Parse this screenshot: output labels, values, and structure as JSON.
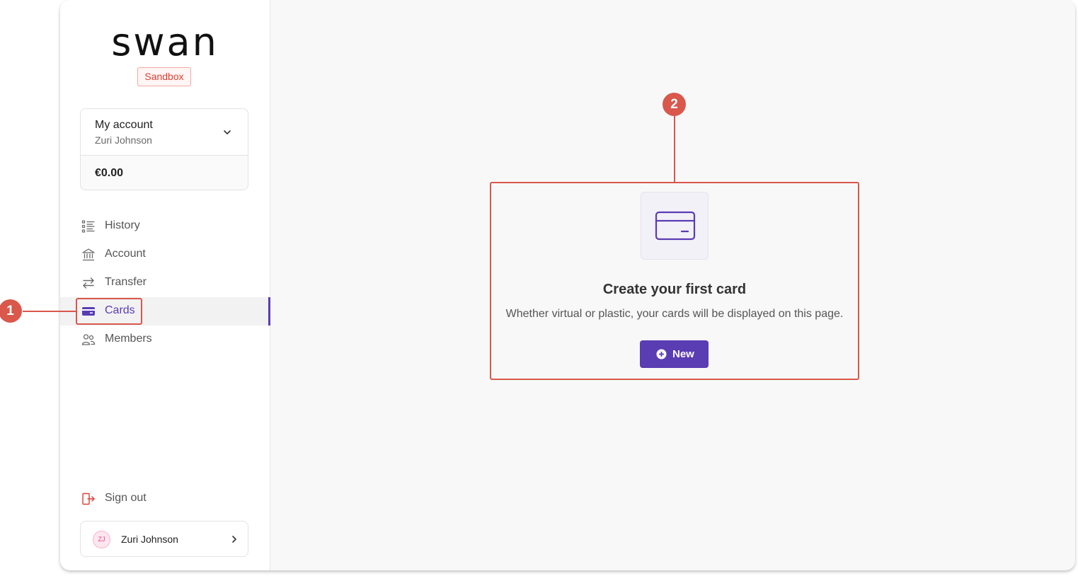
{
  "sidebar": {
    "logo_text": "swan",
    "environment_badge": "Sandbox",
    "account": {
      "title": "My account",
      "holder": "Zuri Johnson",
      "balance": "€0.00"
    },
    "nav": [
      {
        "label": "History",
        "icon": "list-icon"
      },
      {
        "label": "Account",
        "icon": "bank-icon"
      },
      {
        "label": "Transfer",
        "icon": "transfer-icon"
      },
      {
        "label": "Cards",
        "icon": "card-icon",
        "active": true
      },
      {
        "label": "Members",
        "icon": "members-icon"
      }
    ],
    "sign_out_label": "Sign out",
    "user": {
      "initials": "ZJ",
      "name": "Zuri Johnson"
    }
  },
  "main": {
    "empty_state": {
      "title": "Create your first card",
      "description": "Whether virtual or plastic, your cards will be displayed on this page.",
      "button_label": "New"
    }
  },
  "annotations": [
    "1",
    "2"
  ],
  "colors": {
    "accent": "#5a3cb3",
    "annotation": "#d9574b",
    "sign_out": "#dc3f33"
  }
}
